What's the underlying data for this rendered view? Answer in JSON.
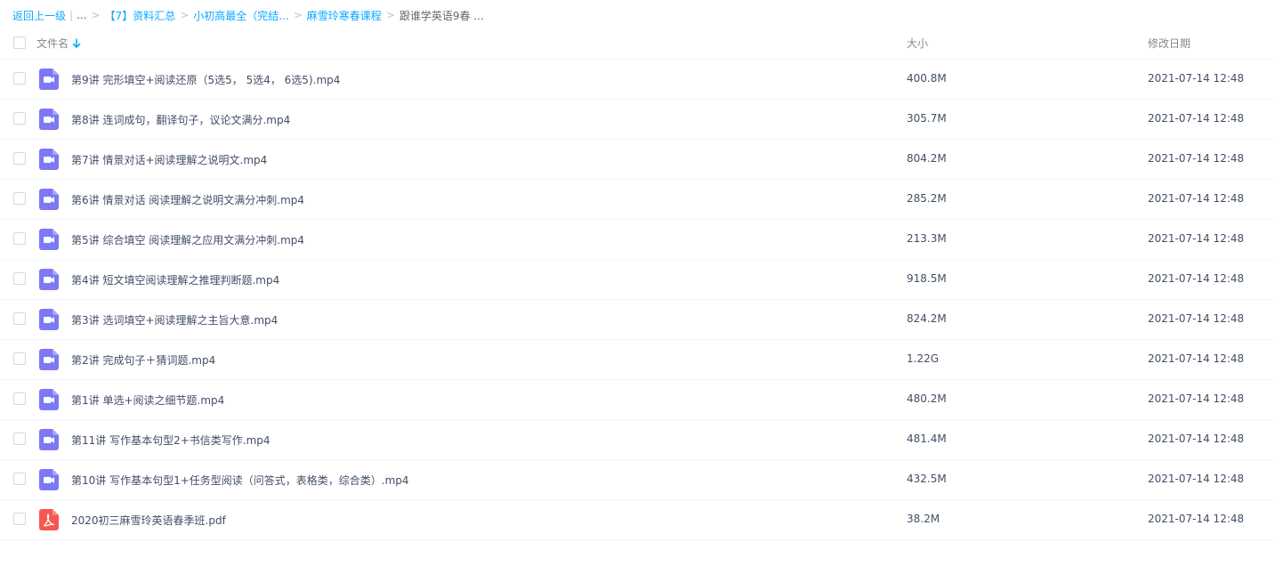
{
  "breadcrumb": {
    "back": "返回上一级",
    "ellipsis": "...",
    "sep": ">",
    "items": [
      "【7】资料汇总",
      "小初高最全（完结...",
      "麻雪玲寒春课程"
    ],
    "current": "跟谁学英语9春 ..."
  },
  "header": {
    "name": "文件名",
    "size": "大小",
    "date": "修改日期"
  },
  "colors": {
    "link": "#09aaff",
    "video_icon": "#7c79f5",
    "pdf_icon": "#f5584f"
  },
  "files": [
    {
      "name": "第9讲 完形填空+阅读还原（5选5， 5选4， 6选5).mp4",
      "size": "400.8M",
      "date": "2021-07-14 12:48",
      "icon": "video-icon"
    },
    {
      "name": "第8讲 连词成句，翻译句子，议论文满分.mp4",
      "size": "305.7M",
      "date": "2021-07-14 12:48",
      "icon": "video-icon"
    },
    {
      "name": "第7讲 情景对话+阅读理解之说明文.mp4",
      "size": "804.2M",
      "date": "2021-07-14 12:48",
      "icon": "video-icon"
    },
    {
      "name": "第6讲 情景对话 阅读理解之说明文满分冲刺.mp4",
      "size": "285.2M",
      "date": "2021-07-14 12:48",
      "icon": "video-icon"
    },
    {
      "name": "第5讲 综合填空 阅读理解之应用文满分冲刺.mp4",
      "size": "213.3M",
      "date": "2021-07-14 12:48",
      "icon": "video-icon"
    },
    {
      "name": "第4讲 短文填空阅读理解之推理判断题.mp4",
      "size": "918.5M",
      "date": "2021-07-14 12:48",
      "icon": "video-icon"
    },
    {
      "name": "第3讲 选词填空+阅读理解之主旨大意.mp4",
      "size": "824.2M",
      "date": "2021-07-14 12:48",
      "icon": "video-icon"
    },
    {
      "name": "第2讲 完成句子＋猜词题.mp4",
      "size": "1.22G",
      "date": "2021-07-14 12:48",
      "icon": "video-icon"
    },
    {
      "name": "第1讲 单选+阅读之细节题.mp4",
      "size": "480.2M",
      "date": "2021-07-14 12:48",
      "icon": "video-icon"
    },
    {
      "name": "第11讲 写作基本句型2+书信类写作.mp4",
      "size": "481.4M",
      "date": "2021-07-14 12:48",
      "icon": "video-icon"
    },
    {
      "name": "第10讲 写作基本句型1+任务型阅读（问答式，表格类，综合类）.mp4",
      "size": "432.5M",
      "date": "2021-07-14 12:48",
      "icon": "video-icon"
    },
    {
      "name": "2020初三麻雪玲英语春季班.pdf",
      "size": "38.2M",
      "date": "2021-07-14 12:48",
      "icon": "pdf-icon"
    }
  ]
}
